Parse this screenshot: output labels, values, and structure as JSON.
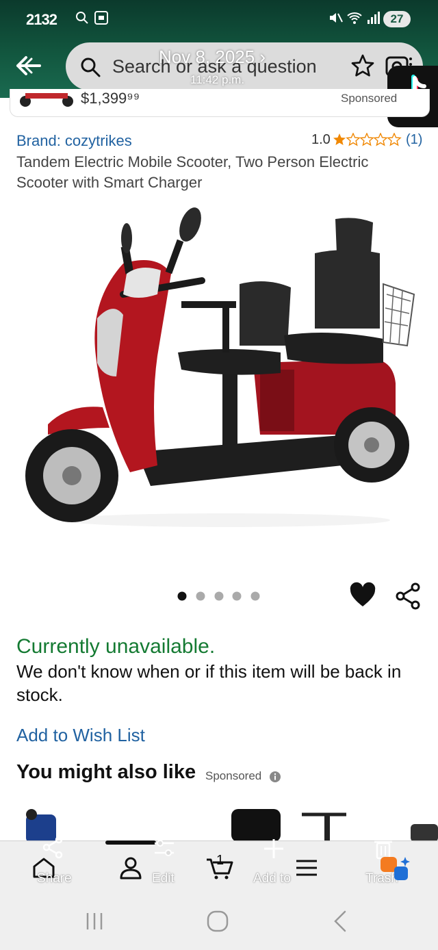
{
  "status": {
    "time": "2132",
    "battery": "27"
  },
  "search": {
    "placeholder": "Search or ask a question"
  },
  "screenshot_overlay": {
    "date": "Nov 8, 2025 ›",
    "time": "11:42 p.m."
  },
  "peek": {
    "price": "$1,399⁹⁹",
    "sponsored": "Sponsored"
  },
  "product": {
    "brand": "Brand: cozytrikes",
    "rating": "1.0",
    "rating_count": "(1)",
    "title": "Tandem Electric Mobile Scooter, Two Person Electric Scooter with Smart Charger",
    "image_count": 5,
    "active_image": 1
  },
  "availability": {
    "status": "Currently unavailable.",
    "message": "We don't know when or if this item will be back in stock."
  },
  "wishlist_link": "Add to Wish List",
  "recommendations": {
    "heading": "You might also like",
    "sponsored": "Sponsored"
  },
  "bottom_bar": {
    "share": "Share",
    "edit": "Edit",
    "add_to": "Add to",
    "trash": "Trash",
    "cart_count": "1"
  },
  "colors": {
    "brand_link": "#2162a1",
    "unavailable": "#147a32",
    "header": "#12573f",
    "star": "#f08804"
  }
}
